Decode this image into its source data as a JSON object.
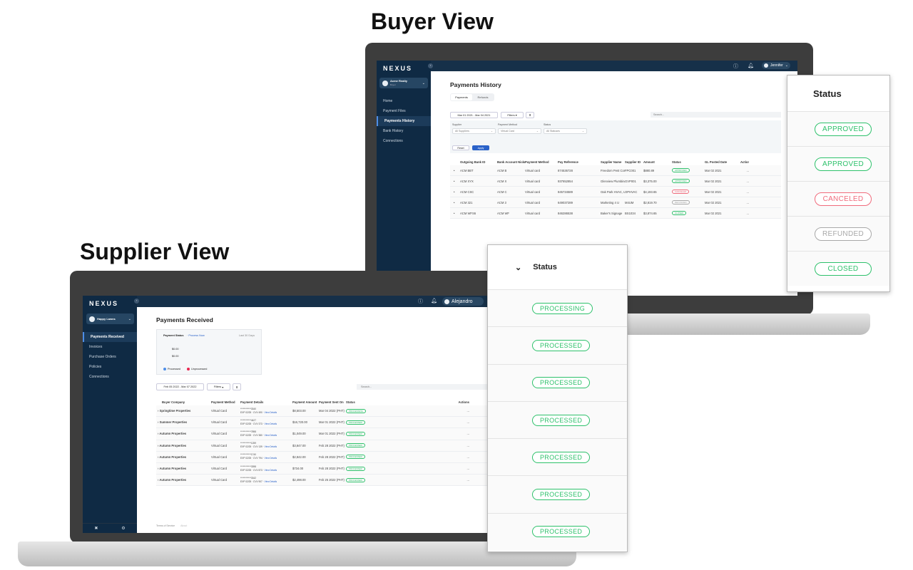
{
  "buyer": {
    "view_title": "Buyer View",
    "logo": "NEXUS",
    "org_name": "Acme Realty",
    "org_role": "Buyer",
    "user": "Jennifer",
    "nav": [
      "Home",
      "Payment Files",
      "Payments History",
      "Bank History",
      "Connections"
    ],
    "active_nav": 2,
    "page_title": "Payments History",
    "tabs": [
      "Payments",
      "Refunds"
    ],
    "date_range": "Mar 01 2021 - Mar 04 2021",
    "filters_label": "Filters",
    "search_placeholder": "Search...",
    "filter_fields": [
      {
        "label": "Supplier",
        "value": "All Suppliers"
      },
      {
        "label": "Payment Method",
        "value": "Virtual Card"
      },
      {
        "label": "Status",
        "value": "All Statuses"
      }
    ],
    "reset_label": "Reset",
    "apply_label": "Apply",
    "columns": [
      "Outgoing Bank ID",
      "Bank Account Nickname",
      "Payment Method",
      "Pay Reference",
      "Supplier Name",
      "Supplier ID",
      "Amount",
      "Status",
      "GL Posted Date",
      "Actions"
    ],
    "rows": [
      [
        "ACM BBT",
        "ACM B",
        "Virtual card",
        "874536728",
        "Freedom Pest Control",
        "FPC001",
        "$880.89",
        "APPROVED",
        "Mar 02 2021",
        "..."
      ],
      [
        "ACM XYX",
        "ACM X",
        "Virtual card",
        "937652854",
        "Glenview Plumbing",
        "GVP001",
        "$3,375.00",
        "APPROVED",
        "Mar 02 2021",
        "..."
      ],
      [
        "ACM CSC",
        "ACM C",
        "Virtual card",
        "845734589",
        "Oak Park HVAC, LLC",
        "OPHVAC",
        "$4,193.65",
        "CANCELED",
        "Mar 02 2021",
        "..."
      ],
      [
        "ACM 321",
        "ACM 3",
        "Virtual card",
        "649037289",
        "Marketing 4 U",
        "M4UM",
        "$2,819.70",
        "REFUNDED",
        "Mar 02 2021",
        "..."
      ],
      [
        "ACM WFS6",
        "ACM WF",
        "Virtual card",
        "846286538",
        "Baker's Signage",
        "BS1034",
        "$3,874.65",
        "CLOSED",
        "Mar 02 2021",
        "..."
      ]
    ],
    "status_card": {
      "header": "Status",
      "items": [
        "APPROVED",
        "APPROVED",
        "CANCELED",
        "REFUNDED",
        "CLOSED"
      ]
    }
  },
  "supplier": {
    "view_title": "Supplier View",
    "logo": "NEXUS",
    "org_name": "Happy Lawns",
    "user": "Alejandro",
    "nav": [
      "Payments Received",
      "Invoices",
      "Purchase Orders",
      "Policies",
      "Connections"
    ],
    "active_nav": 0,
    "page_title": "Payments Received",
    "summary": {
      "title": "Payment Status",
      "link": "Process Now",
      "period": "Last 30 Days",
      "values": [
        "$0.00",
        "$0.00"
      ],
      "legend": [
        "Processed",
        "Unprocessed"
      ]
    },
    "date_range": "Feb 05 2022 - Mar 07 2022",
    "filters_label": "Filters",
    "search_placeholder": "Search...",
    "columns": [
      "Buyer Company",
      "Payment Method",
      "Payment Details",
      "Payment Amount",
      "Payment Sent On",
      "Status",
      "Actions"
    ],
    "rows": [
      {
        "company": "Springtime Properties",
        "method": "Virtual Card",
        "card": "************3340",
        "exp": "EXP 02/25",
        "cvv": "CVV 490",
        "amount": "$8,503.00",
        "sent": "Mar 04 2022 (PHT)",
        "status": "PROCESSING"
      },
      {
        "company": "Summer Properties",
        "method": "Virtual Card",
        "card": "************4427",
        "exp": "EXP 02/25",
        "cvv": "CVV 373",
        "amount": "$16,720.00",
        "sent": "Mar 01 2022 (PHT)",
        "status": "PROCESSED"
      },
      {
        "company": "Autumn Properties",
        "method": "Virtual Card",
        "card": "************7898",
        "exp": "EXP 02/25",
        "cvv": "CVV 380",
        "amount": "$1,049.00",
        "sent": "Mar 01 2022 (PHT)",
        "status": "PROCESSED"
      },
      {
        "company": "Autumn Properties",
        "method": "Virtual Card",
        "card": "************1259",
        "exp": "EXP 02/25",
        "cvv": "CVV 139",
        "amount": "$3,847.00",
        "sent": "Feb 28 2022 (PHT)",
        "status": "PROCESSED"
      },
      {
        "company": "Autumn Properties",
        "method": "Virtual Card",
        "card": "************1740",
        "exp": "EXP 02/25",
        "cvv": "CVV 794",
        "amount": "$2,842.00",
        "sent": "Feb 28 2022 (PHT)",
        "status": "PROCESSED"
      },
      {
        "company": "Autumn Properties",
        "method": "Virtual Card",
        "card": "************3398",
        "exp": "EXP 02/25",
        "cvv": "CVV 873",
        "amount": "$734.00",
        "sent": "Feb 28 2022 (PHT)",
        "status": "PROCESSED"
      },
      {
        "company": "Autumn Properties",
        "method": "Virtual Card",
        "card": "************3342",
        "exp": "EXP 02/25",
        "cvv": "CVV 907",
        "amount": "$2,498.00",
        "sent": "Feb 25 2022 (PHT)",
        "status": "PROCESSED"
      }
    ],
    "view_details_label": "View Details",
    "footer": [
      "Terms of Service",
      "About"
    ],
    "status_card": {
      "header": "Status",
      "items": [
        "PROCESSING",
        "PROCESSED",
        "PROCESSED",
        "PROCESSED",
        "PROCESSED",
        "PROCESSED",
        "PROCESSED"
      ]
    }
  },
  "colors": {
    "navy": "#0f2a44",
    "accent": "#2a62c9",
    "approved": "#2ec16b",
    "canceled": "#f06b7c",
    "refunded": "#a8a8a8",
    "processed_legend": "#4d8ee8",
    "unprocessed_legend": "#e8264f"
  }
}
